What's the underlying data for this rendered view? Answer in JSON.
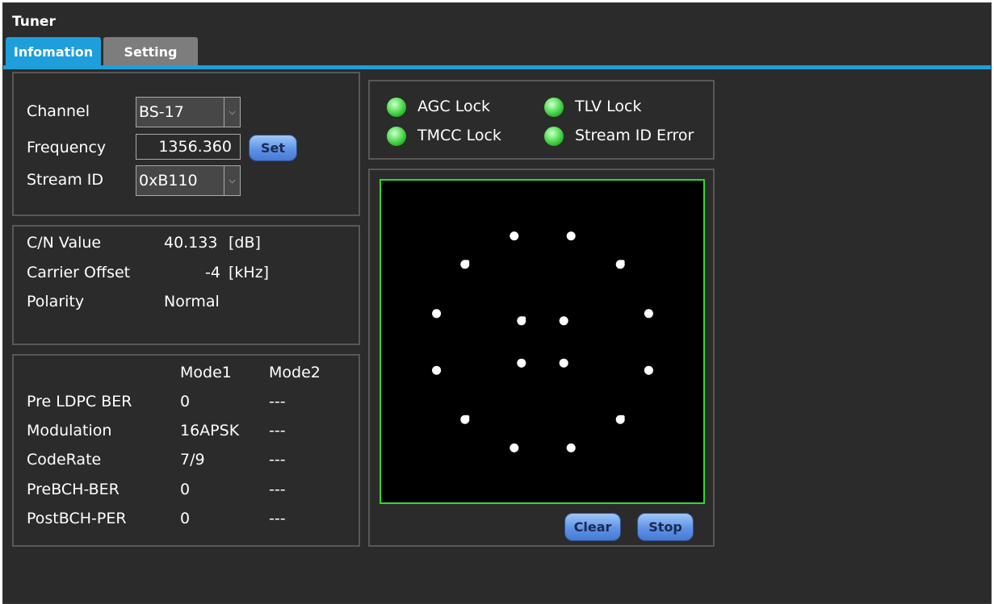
{
  "window": {
    "title": "Tuner"
  },
  "tabs": [
    {
      "label": "Infomation",
      "active": true
    },
    {
      "label": "Setting",
      "active": false
    }
  ],
  "tuning": {
    "channel_label": "Channel",
    "channel_value": "BS-17",
    "frequency_label": "Frequency",
    "frequency_value": "1356.360",
    "set_button": "Set",
    "stream_id_label": "Stream ID",
    "stream_id_value": "0xB110"
  },
  "signal": {
    "cn_label": "C/N Value",
    "cn_value": "40.133",
    "cn_unit": "[dB]",
    "offset_label": "Carrier Offset",
    "offset_value": "-4",
    "offset_unit": "[kHz]",
    "polarity_label": "Polarity",
    "polarity_value": "Normal"
  },
  "modes": {
    "headers": [
      "Mode1",
      "Mode2"
    ],
    "rows": [
      {
        "label": "Pre LDPC BER",
        "mode1": "0",
        "mode2": "---"
      },
      {
        "label": "Modulation",
        "mode1": "16APSK",
        "mode2": "---"
      },
      {
        "label": "CodeRate",
        "mode1": "7/9",
        "mode2": "---"
      },
      {
        "label": "PreBCH-BER",
        "mode1": "0",
        "mode2": "---"
      },
      {
        "label": "PostBCH-PER",
        "mode1": "0",
        "mode2": "---"
      }
    ]
  },
  "status": [
    {
      "label": "AGC Lock",
      "state": "on",
      "color": "#33cc33"
    },
    {
      "label": "TLV Lock",
      "state": "on",
      "color": "#33cc33"
    },
    {
      "label": "TMCC Lock",
      "state": "on",
      "color": "#33cc33"
    },
    {
      "label": "Stream ID Error",
      "state": "on",
      "color": "#33cc33"
    }
  ],
  "constellation": {
    "clear_button": "Clear",
    "stop_button": "Stop"
  },
  "colors": {
    "accent": "#1e9fdc",
    "scope_border": "#2bdc2b",
    "background": "#2b2b2b"
  }
}
